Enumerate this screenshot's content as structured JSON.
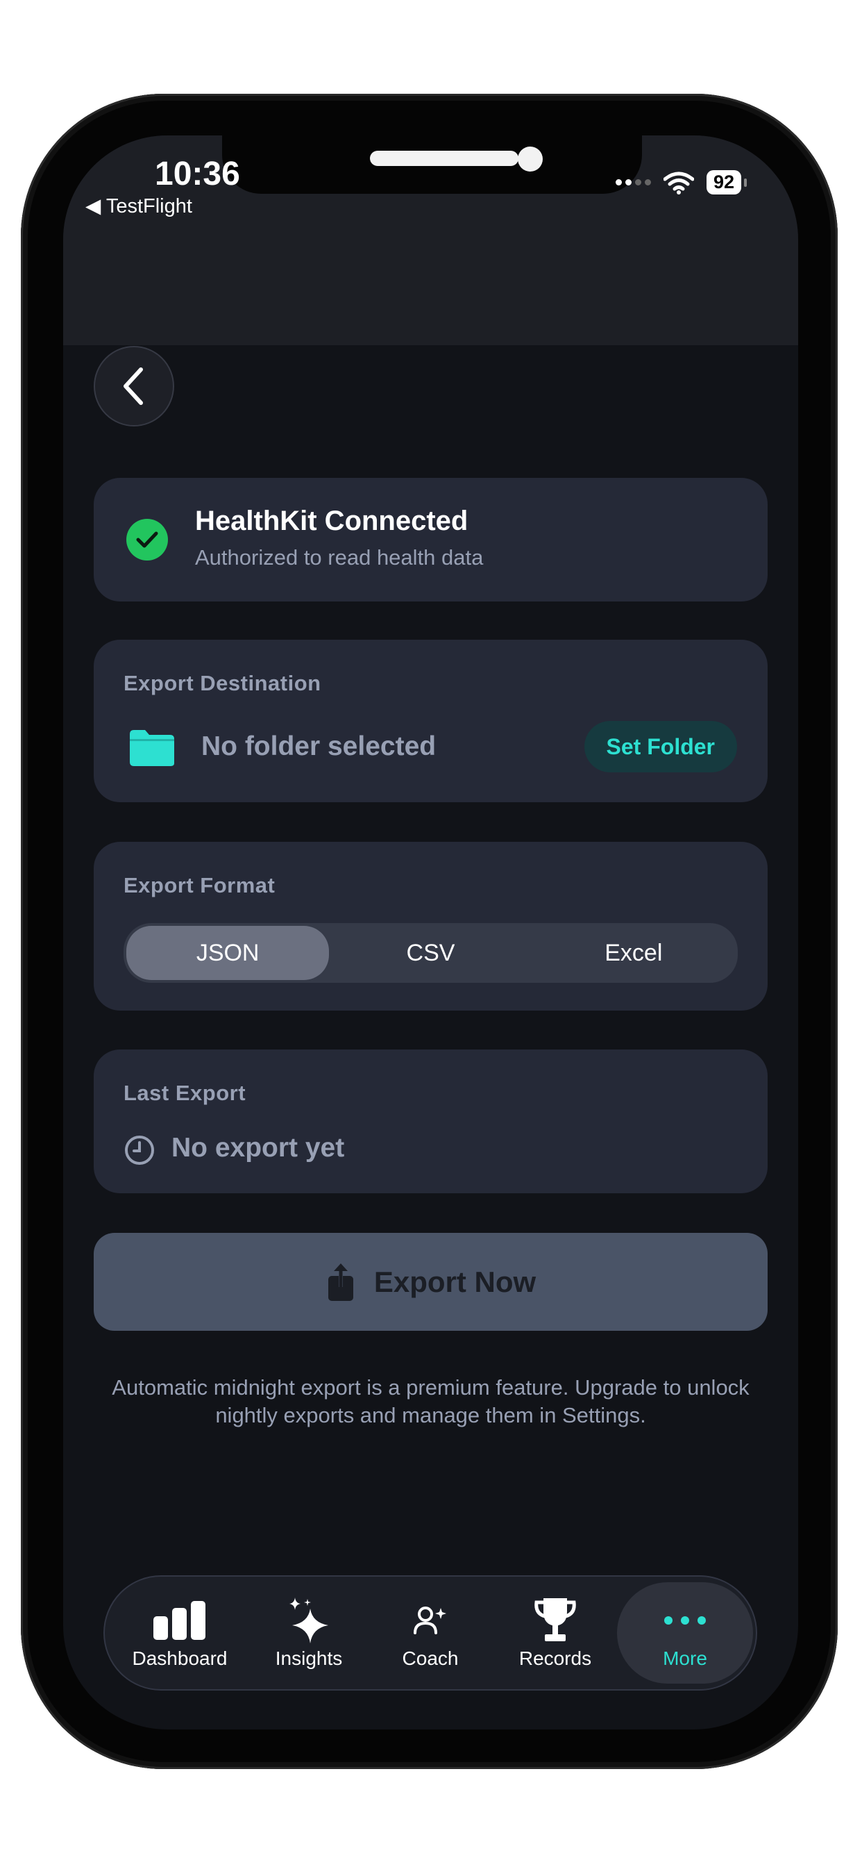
{
  "status_bar": {
    "time": "10:36",
    "back_app": "◀ TestFlight",
    "battery": "92"
  },
  "healthkit": {
    "title": "HealthKit Connected",
    "subtitle": "Authorized to read health data"
  },
  "destination": {
    "label": "Export Destination",
    "value": "No folder selected",
    "button": "Set Folder"
  },
  "format": {
    "label": "Export Format",
    "options": [
      "JSON",
      "CSV",
      "Excel"
    ],
    "selected": "JSON"
  },
  "last_export": {
    "label": "Last Export",
    "value": "No export yet"
  },
  "export_button": "Export Now",
  "note": "Automatic midnight export is a premium feature. Upgrade to unlock nightly exports and manage them in Settings.",
  "tabs": [
    {
      "label": "Dashboard",
      "icon": "bar-chart-icon"
    },
    {
      "label": "Insights",
      "icon": "sparkles-icon"
    },
    {
      "label": "Coach",
      "icon": "person-sparkle-icon"
    },
    {
      "label": "Records",
      "icon": "trophy-icon"
    },
    {
      "label": "More",
      "icon": "ellipsis-icon",
      "active": true
    }
  ],
  "colors": {
    "accent": "#2de0d1",
    "success": "#22c55e",
    "card": "#252937",
    "background": "#111318"
  }
}
